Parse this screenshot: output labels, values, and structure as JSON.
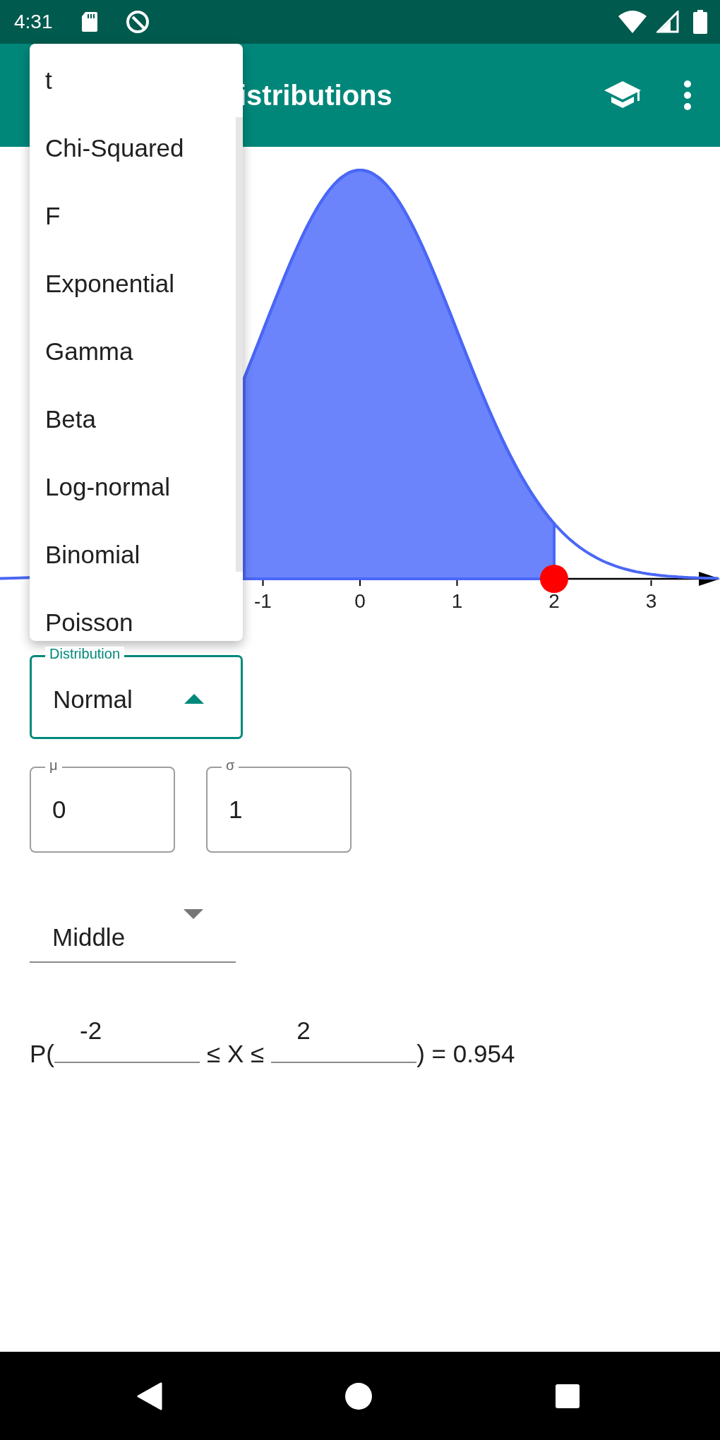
{
  "status_bar": {
    "time": "4:31"
  },
  "app_bar": {
    "title": "istributions"
  },
  "chart": {
    "tick_labels": [
      "-1",
      "0",
      "1",
      "2",
      "3"
    ]
  },
  "distribution_menu": {
    "items": [
      {
        "label": "t",
        "selected": false
      },
      {
        "label": "Chi-Squared",
        "selected": false
      },
      {
        "label": "F",
        "selected": false
      },
      {
        "label": "Exponential",
        "selected": false
      },
      {
        "label": "Gamma",
        "selected": false
      },
      {
        "label": "Beta",
        "selected": false
      },
      {
        "label": "Log-normal",
        "selected": false
      },
      {
        "label": "Binomial",
        "selected": false
      },
      {
        "label": "Poisson",
        "selected": false
      }
    ]
  },
  "distribution_field": {
    "label": "Distribution",
    "value": "Normal",
    "open": true
  },
  "parameters": [
    {
      "label": "μ",
      "value": "0"
    },
    {
      "label": "σ",
      "value": "1"
    }
  ],
  "region_select": {
    "value": "Middle"
  },
  "probability": {
    "prefix": "P(",
    "lower": "-2",
    "between": "≤ X ≤",
    "upper": "2",
    "result": ") = 0.954"
  }
}
